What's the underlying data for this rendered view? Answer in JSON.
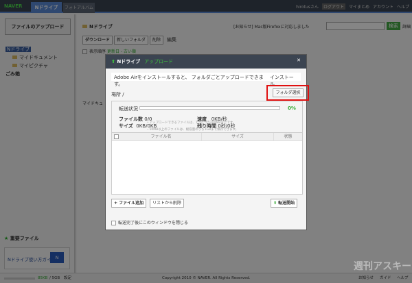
{
  "top": {
    "logo": "NAVER",
    "tabs": [
      "Nドライブ",
      "フォトアルバム"
    ],
    "user": "hirotusさん",
    "logout": "ログアウト",
    "links": [
      "マイまとめ",
      "アカウント",
      "ヘルプ"
    ]
  },
  "sidebar": {
    "upload": "ファイルのアップロード",
    "root": "Nドライブ",
    "folders": [
      "マイドキュメント",
      "マイピクチャ"
    ],
    "trash": "ごみ箱",
    "important": "重要ファイル",
    "guide": "Nドライブ使い方ガイド"
  },
  "main": {
    "title": "Nドライブ",
    "notice": "[お知らせ] Mac版Firefoxに対応しました",
    "search": "検索",
    "detail": "詳細",
    "toolbar": [
      "ダウンロード",
      "新しいフォルダ",
      "削除",
      "編集"
    ],
    "sort_label": "表示順序",
    "sort_value": "更新日 - 古い順",
    "folder_label": "マイドキュ"
  },
  "modal": {
    "title": "Nドライブ",
    "subtitle": "アップロード",
    "air": "Adobe Airをインストールすると、 フォルダごとアップロードできます。",
    "install": "インストール",
    "location_label": "場所",
    "location": "/",
    "folder_select": "フォルダ選択",
    "status_label": "転送状況",
    "progress": "0%",
    "progress_value": 0,
    "file_count_label": "ファイル数",
    "file_count": "0/0",
    "size_label": "サイズ",
    "size": "0KB/0KB",
    "speed_label": "速度",
    "speed": "0KB/秒",
    "remaining_label": "残り時間",
    "remaining": "0秒/0秒",
    "columns": [
      "ファイル名",
      "サイズ",
      "状態"
    ],
    "notes": [
      "・アップロードできるファイルは、1つにつき200MBまでです。",
      "・50MB以上のファイルは、総容量のうち1GBまで保存できます。"
    ],
    "add": "+ ファイル追加",
    "remove": "リストから削除",
    "start": "転送開始",
    "close_after": "転送完了後にこのウィンドウを閉じる"
  },
  "footer": {
    "used": "85KB",
    "total": "5GB",
    "settings": "設定",
    "copyright": "Copyright 2010 © NAVER. All Rights Reserved.",
    "links": [
      "お知らせ",
      "ガイド",
      "ヘルプ"
    ]
  },
  "watermark": "週刊アスキー"
}
